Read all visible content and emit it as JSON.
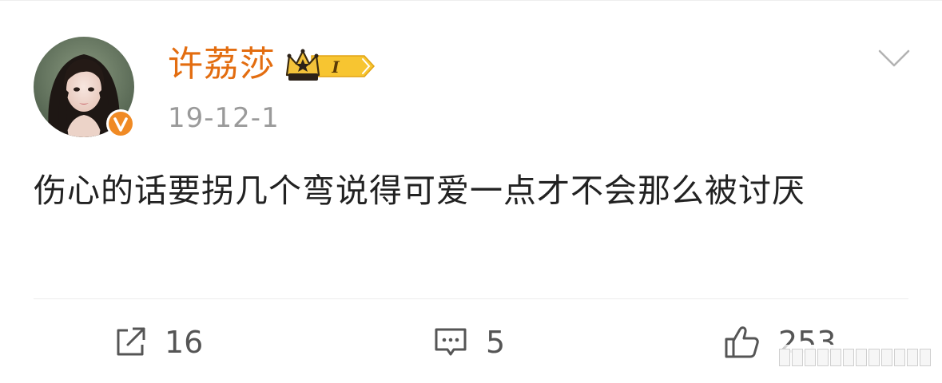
{
  "post": {
    "username": "许荔莎",
    "vip_level": "I",
    "date": "19-12-1",
    "text": "伤心的话要拐几个弯说得可爱一点才不会那么被讨厌"
  },
  "actions": {
    "repost_count": "16",
    "comment_count": "5",
    "like_count": "253"
  },
  "colors": {
    "username": "#e36d10",
    "verified_badge": "#f08a24",
    "date": "#9a9a9a",
    "body_text": "#222222"
  },
  "icons": {
    "menu": "chevron-down-icon",
    "verified": "verified-v-icon",
    "vip": "crown-icon",
    "repost": "repost-icon",
    "comment": "comment-icon",
    "like": "thumbs-up-icon"
  }
}
